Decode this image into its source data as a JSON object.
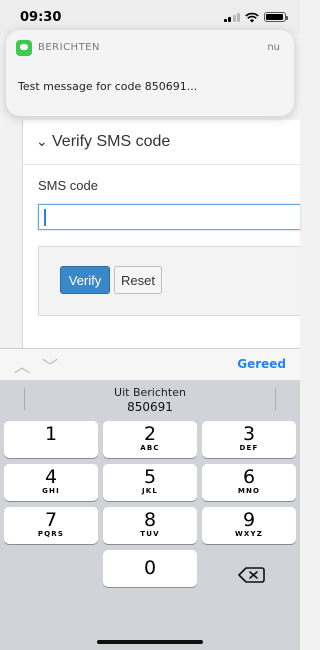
{
  "status": {
    "time": "09:30"
  },
  "notification": {
    "app": "BERICHTEN",
    "time": "nu",
    "message": "Test message for code 850691..."
  },
  "form": {
    "section_title": "Verify SMS code",
    "field_label": "SMS code",
    "input_value": "",
    "verify_label": "Verify",
    "reset_label": "Reset"
  },
  "accessory": {
    "done_label": "Gereed"
  },
  "keyboard": {
    "suggestion_from": "Uit Berichten",
    "suggestion_code": "850691",
    "keys": [
      {
        "num": "1",
        "letters": ""
      },
      {
        "num": "2",
        "letters": "ABC"
      },
      {
        "num": "3",
        "letters": "DEF"
      },
      {
        "num": "4",
        "letters": "GHI"
      },
      {
        "num": "5",
        "letters": "JKL"
      },
      {
        "num": "6",
        "letters": "MNO"
      },
      {
        "num": "7",
        "letters": "PQRS"
      },
      {
        "num": "8",
        "letters": "TUV"
      },
      {
        "num": "9",
        "letters": "WXYZ"
      },
      {
        "num": "0",
        "letters": ""
      }
    ]
  },
  "icons": {
    "app": "messages-icon",
    "signal": "signal-icon",
    "wifi": "wifi-icon",
    "battery": "battery-icon",
    "backspace": "backspace-icon",
    "chevron": "chevron-down-icon",
    "up": "chevron-up-icon",
    "down": "chevron-down-icon"
  },
  "colors": {
    "accent": "#2b7ff0",
    "primary_button": "#3a87c9",
    "messages_green": "#3ec94f"
  }
}
